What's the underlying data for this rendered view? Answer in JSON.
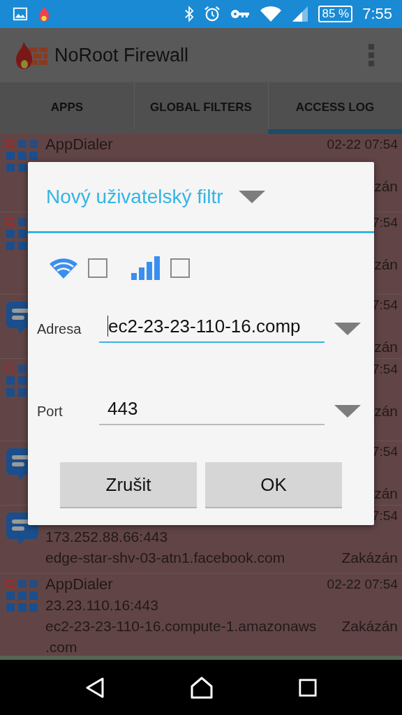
{
  "status_bar": {
    "battery": "85 %",
    "time": "7:55"
  },
  "app_bar": {
    "title": "NoRoot Firewall"
  },
  "tabs": [
    {
      "label": "APPS",
      "selected": false
    },
    {
      "label": "GLOBAL FILTERS",
      "selected": false
    },
    {
      "label": "ACCESS LOG",
      "selected": true
    }
  ],
  "log": [
    {
      "kind": "grid",
      "color": "#614546",
      "app": "AppDialer",
      "time": "02-22 07:54",
      "result": "zán"
    },
    {
      "kind": "grid",
      "color": "#614546",
      "time": "7:54",
      "result": "zán"
    },
    {
      "kind": "chat",
      "color": "#614546",
      "time": "7:54",
      "result": "zán"
    },
    {
      "kind": "grid",
      "color": "#614546",
      "time": "7:54",
      "result": "zán"
    },
    {
      "kind": "chat",
      "color": "#614546",
      "time": "7:54",
      "result": "zán"
    },
    {
      "kind": "chat",
      "color": "#614546",
      "time": "7:54",
      "address": "173.252.88.66:443",
      "host": "edge-star-shv-03-atn1.facebook.com",
      "result": "Zakázán"
    },
    {
      "kind": "grid",
      "color": "#614546",
      "app": "AppDialer",
      "time": "02-22 07:54",
      "address": "23.23.110.16:443",
      "host": "ec2-23-23-110-16.compute-1.amazonaws\n.com",
      "result": "Zakázán"
    },
    {
      "color": "#4f6a52"
    }
  ],
  "dialog": {
    "title": "Nový uživatelský filtr",
    "networks": [
      {
        "kind": "wifi",
        "checked": false
      },
      {
        "kind": "mobile",
        "checked": false
      }
    ],
    "fields": [
      {
        "label": "Adresa",
        "value": "ec2-23-23-110-16.comp",
        "focused": true
      },
      {
        "label": "Port",
        "value": "443",
        "focused": false
      }
    ],
    "buttons": [
      "Zrušit",
      "OK"
    ]
  }
}
